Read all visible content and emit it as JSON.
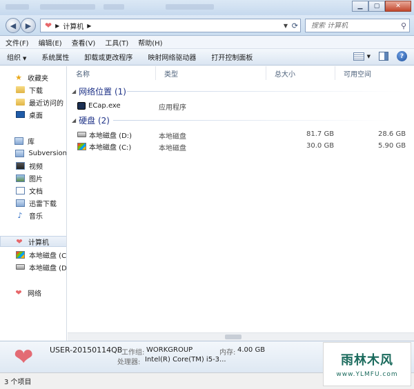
{
  "address": {
    "path_label": "计算机",
    "search_placeholder": "搜索 计算机"
  },
  "menu": [
    "文件(F)",
    "编辑(E)",
    "查看(V)",
    "工具(T)",
    "帮助(H)"
  ],
  "toolbar": [
    "组织",
    "系统属性",
    "卸载或更改程序",
    "映射网络驱动器",
    "打开控制面板"
  ],
  "sidebar": {
    "favorites": {
      "label": "收藏夹",
      "items": [
        "下载",
        "最近访问的",
        "桌面"
      ]
    },
    "libraries": {
      "label": "库",
      "items": [
        "Subversion",
        "视频",
        "图片",
        "文档",
        "迅雷下载",
        "音乐"
      ]
    },
    "computer": {
      "label": "计算机",
      "items": [
        "本地磁盘 (C",
        "本地磁盘 (D"
      ]
    },
    "network": {
      "label": "网络"
    }
  },
  "columns": [
    "名称",
    "类型",
    "总大小",
    "可用空间"
  ],
  "groups": [
    {
      "title": "网络位置 (1)",
      "items": [
        {
          "name": "ECap.exe",
          "type": "应用程序",
          "total": "",
          "free": ""
        }
      ]
    },
    {
      "title": "硬盘 (2)",
      "items": [
        {
          "name": "本地磁盘 (D:)",
          "type": "本地磁盘",
          "total": "81.7 GB",
          "free": "28.6 GB"
        },
        {
          "name": "本地磁盘 (C:)",
          "type": "本地磁盘",
          "total": "30.0 GB",
          "free": "5.90 GB"
        }
      ]
    }
  ],
  "details": {
    "computer_name": "USER-20150114QB",
    "workgroup_label": "工作组:",
    "workgroup_value": "WORKGROUP",
    "memory_label": "内存:",
    "memory_value": "4.00 GB",
    "processor_label": "处理器:",
    "processor_value": "Intel(R) Core(TM) i5-3..."
  },
  "status": "3 个项目",
  "watermark": {
    "title": "雨林木风",
    "url": "www.YLMFU.com"
  }
}
